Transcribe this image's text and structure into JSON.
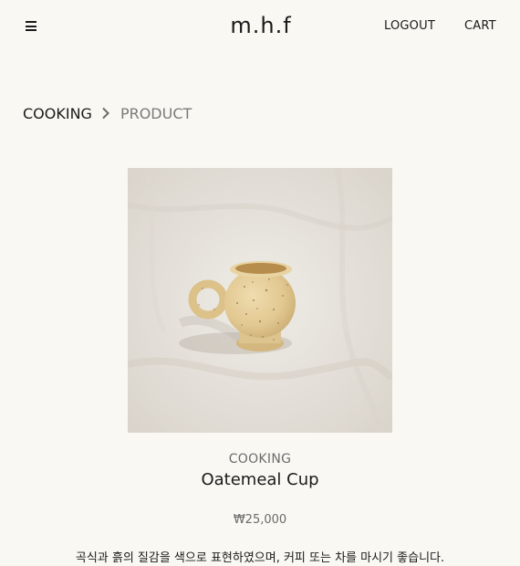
{
  "header": {
    "menu_icon": "hamburger-menu-icon",
    "logo": "m.h.f",
    "logout_label": "LOGOUT",
    "cart_label": "CART"
  },
  "breadcrumb": {
    "category": "COOKING",
    "separator_icon": "chevron-right-icon",
    "current": "PRODUCT"
  },
  "product": {
    "image_alt": "Speckled ceramic cup on white linen",
    "category": "COOKING",
    "name": "Oatemeal Cup",
    "price": "₩25,000",
    "description": "곡식과 흙의 질감을 색으로 표현하였으며, 커피 또는 차를 마시기 좋습니다."
  },
  "colors": {
    "background": "#faf8f3",
    "text": "#1a1a1a",
    "muted": "#7a7a7a"
  }
}
